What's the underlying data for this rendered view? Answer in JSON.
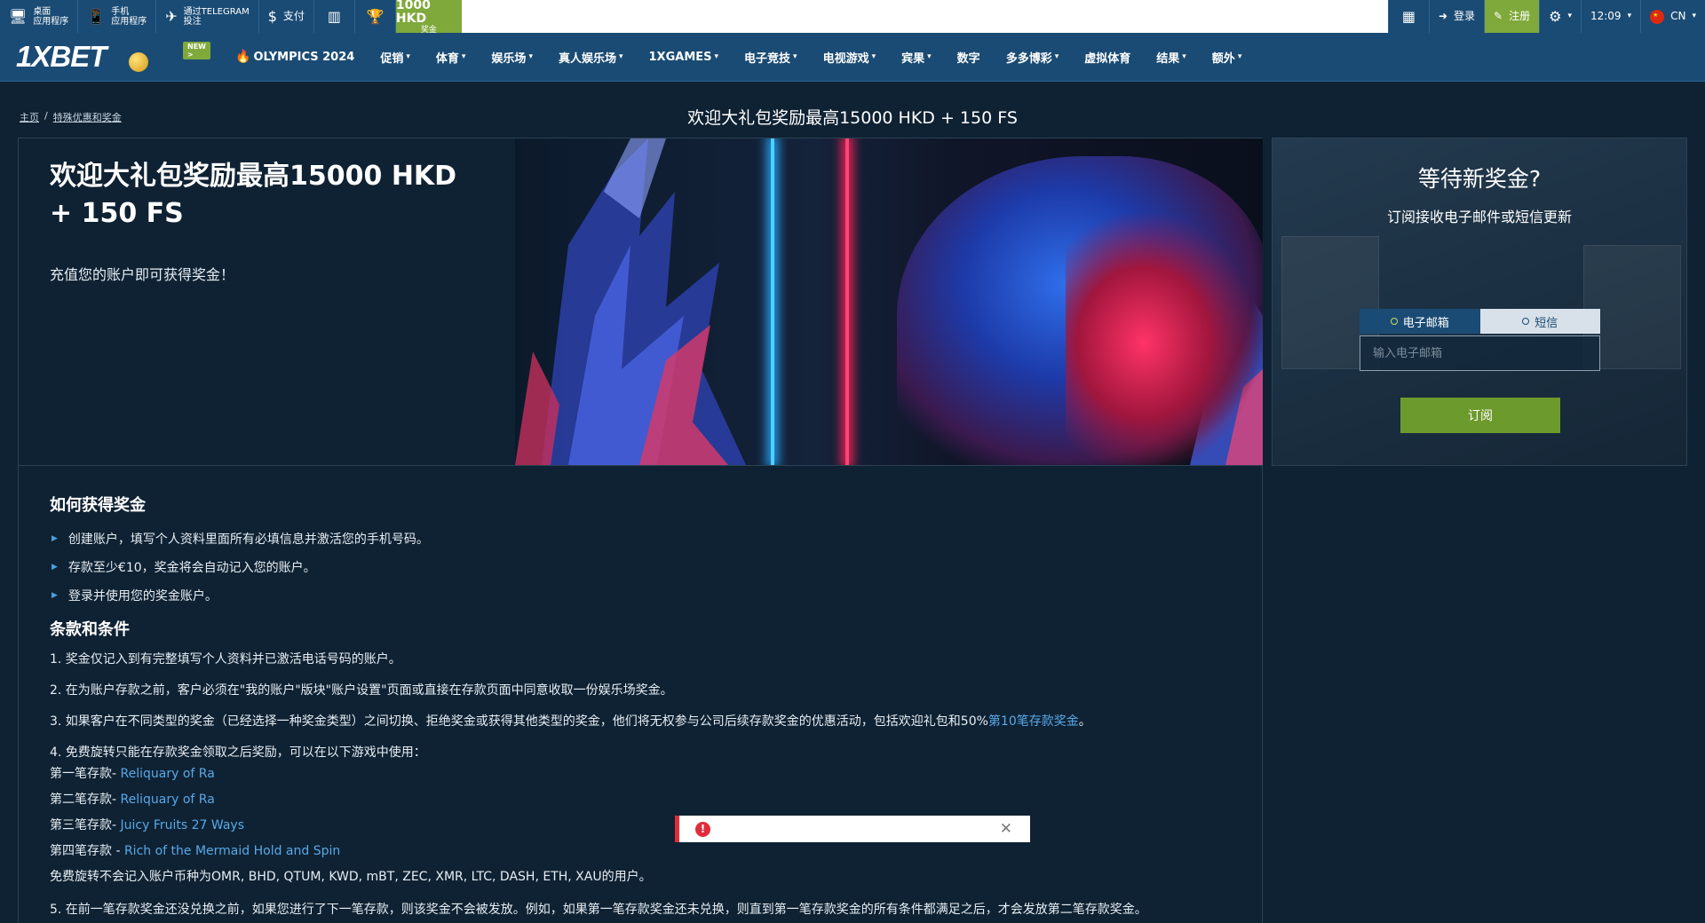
{
  "topbar": {
    "desktop_app": "桌面\n应用程序",
    "mobile_app": "手机\n应用程序",
    "telegram": "通过TELEGRAM\n投注",
    "pay": "支付",
    "bonus_amount": "1000 HKD",
    "bonus_label": "奖金",
    "login": "登录",
    "register": "注册",
    "time": "12:09",
    "lang": "CN"
  },
  "nav": {
    "logo": "1XBET",
    "new_badge": "NEW >",
    "items": [
      {
        "label": "OLYMPICS 2024",
        "chevron": false
      },
      {
        "label": "促销",
        "chevron": true
      },
      {
        "label": "体育",
        "chevron": true
      },
      {
        "label": "娱乐场",
        "chevron": true
      },
      {
        "label": "真人娱乐场",
        "chevron": true
      },
      {
        "label": "1XGAMES",
        "chevron": true
      },
      {
        "label": "电子竞技",
        "chevron": true
      },
      {
        "label": "电视游戏",
        "chevron": true
      },
      {
        "label": "宾果",
        "chevron": true
      },
      {
        "label": "数字",
        "chevron": false
      },
      {
        "label": "多多博彩",
        "chevron": true
      },
      {
        "label": "虚拟体育",
        "chevron": false
      },
      {
        "label": "结果",
        "chevron": true
      },
      {
        "label": "额外",
        "chevron": true
      }
    ]
  },
  "breadcrumb": {
    "home": "主页",
    "sep": "/",
    "current": "特殊优惠和奖金"
  },
  "page_title": "欢迎大礼包奖励最高15000 HKD + 150 FS",
  "promo": {
    "heading": "欢迎大礼包奖励最高15000 HKD + 150 FS",
    "subtext": "充值您的账户即可获得奖金！"
  },
  "subscribe": {
    "title": "等待新奖金?",
    "desc": "订阅接收电子邮件或短信更新",
    "tab_email": "电子邮箱",
    "tab_sms": "短信",
    "placeholder": "输入电子邮箱",
    "button": "订阅"
  },
  "how": {
    "title": "如何获得奖金",
    "items": [
      "创建账户，填写个人资料里面所有必填信息并激活您的手机号码。",
      "存款至少€10，奖金将会自动记入您的账户。",
      "登录并使用您的奖金账户。"
    ]
  },
  "terms": {
    "title": "条款和条件",
    "t1": "1. 奖金仅记入到有完整填写个人资料并已激活电话号码的账户。",
    "t2": "2. 在为账户存款之前，客户必须在\"我的账户\"版块\"账户设置\"页面或直接在存款页面中同意收取一份娱乐场奖金。",
    "t3_text": "3. 如果客户在不同类型的奖金（已经选择一种奖金类型）之间切换、拒绝奖金或获得其他类型的奖金，他们将无权参与公司后续存款奖金的优惠活动，包括欢迎礼包和50%",
    "t3_link": "第10笔存款奖金",
    "t3_end": "。",
    "t4": "4. 免费旋转只能在存款奖金领取之后奖励，可以在以下游戏中使用：",
    "deposits": [
      {
        "label": "第一笔存款- ",
        "game": "Reliquary of Ra"
      },
      {
        "label": "第二笔存款- ",
        "game": "Reliquary of Ra"
      },
      {
        "label": "第三笔存款- ",
        "game": "Juicy Fruits 27 Ways"
      },
      {
        "label": "第四笔存款 - ",
        "game": "Rich of the Mermaid Hold and Spin"
      }
    ],
    "fs_note": "免费旋转不会记入账户币种为OMR, BHD, QTUM, KWD, mBT, ZEC, XMR, LTC, DASH, ETH, XAU的用户。",
    "t5": "5. 在前一笔存款奖金还没兑换之前，如果您进行了下一笔存款，则该奖金不会被发放。例如，如果第一笔存款奖金还未兑换，则直到第一笔存款奖金的所有条件都满足之后，才会发放第二笔存款奖金。"
  },
  "colors": {
    "nav_blue": "#1a4b74",
    "accent_green": "#7fa93a",
    "link_blue": "#58a9e8",
    "error_red": "#e12d3a"
  }
}
